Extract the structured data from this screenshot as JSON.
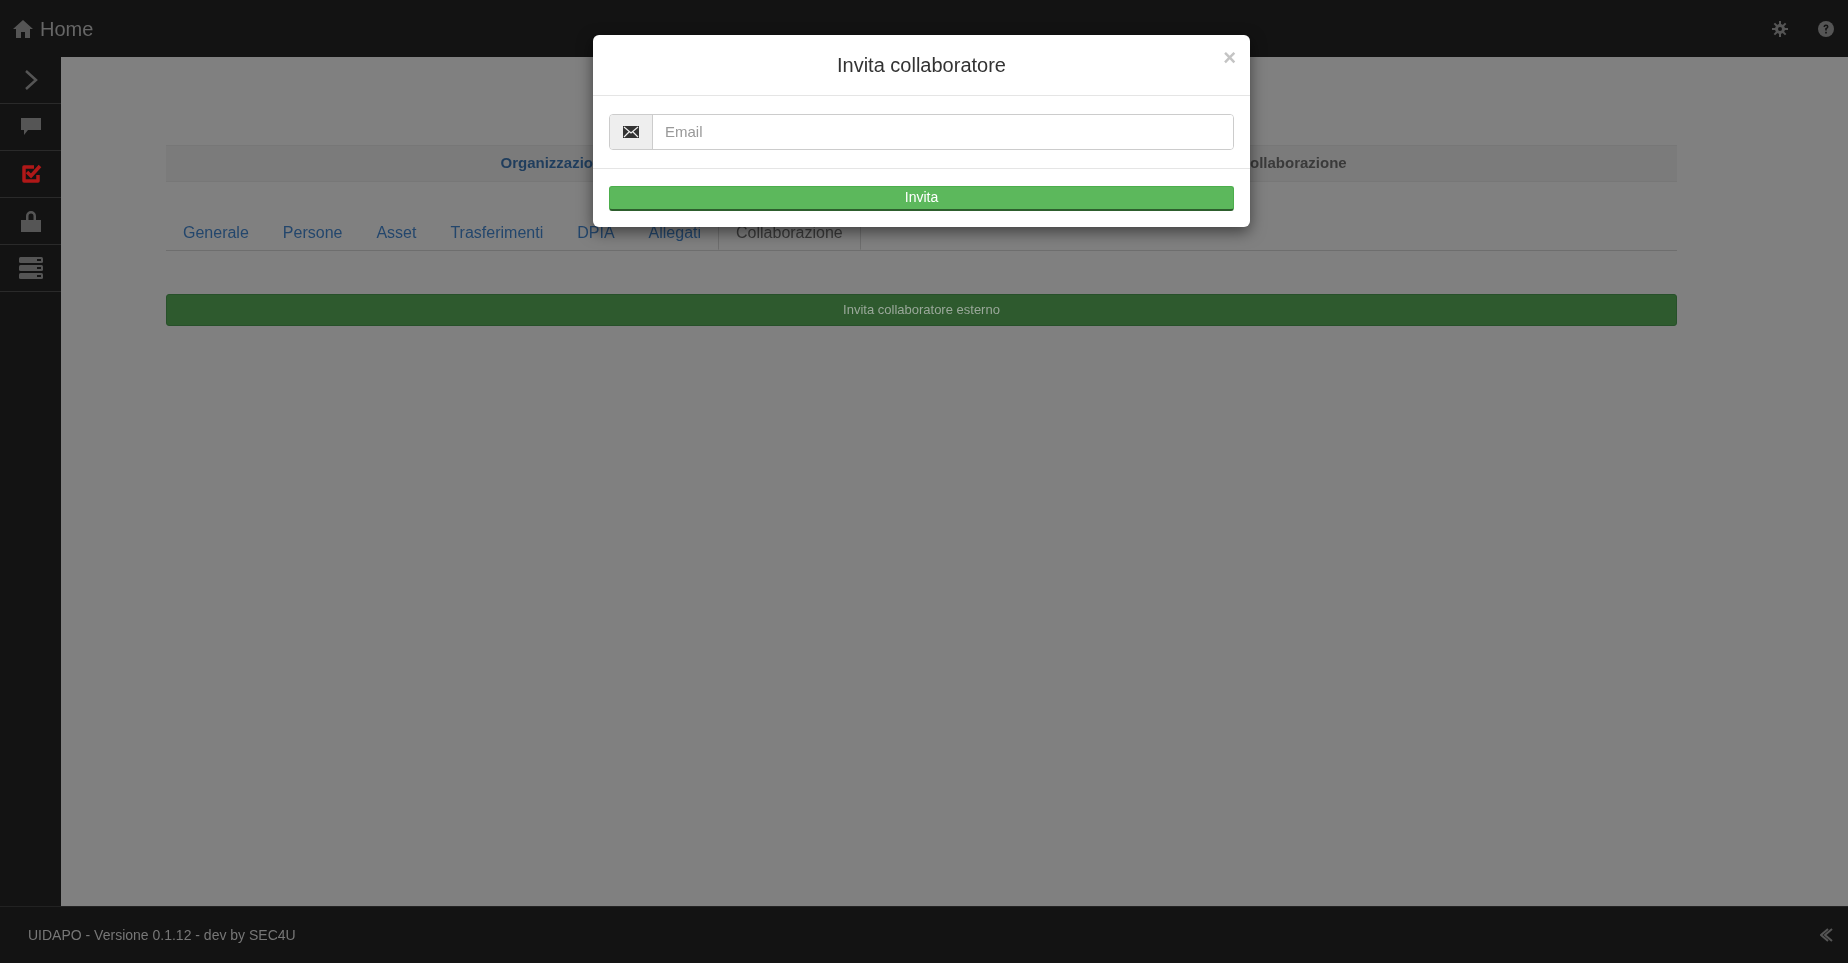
{
  "header": {
    "title": "Home"
  },
  "sidebar": {
    "items": [
      {
        "kind": "expand",
        "selected": false
      },
      {
        "kind": "chat",
        "selected": false
      },
      {
        "kind": "tasks",
        "selected": true
      },
      {
        "kind": "lock",
        "selected": false
      },
      {
        "kind": "servers",
        "selected": false
      }
    ]
  },
  "breadcrumb": [
    "Organizzazio",
    "ollaborazione"
  ],
  "tabs": [
    {
      "label": "Generale",
      "selected": false
    },
    {
      "label": "Persone",
      "selected": false
    },
    {
      "label": "Asset",
      "selected": false
    },
    {
      "label": "Trasferimenti",
      "selected": false
    },
    {
      "label": "DPIA",
      "selected": false
    },
    {
      "label": "Allegati",
      "selected": false
    },
    {
      "label": "Collaborazione",
      "selected": true
    }
  ],
  "invite_button": "Invita collaboratore esterno",
  "modal": {
    "title": "Invita collaboratore",
    "close": "×",
    "email": {
      "placeholder": "Email"
    },
    "submit": "Invita"
  },
  "footer": "UIDAPO - Versione 0.1.12 - dev by SEC4U"
}
